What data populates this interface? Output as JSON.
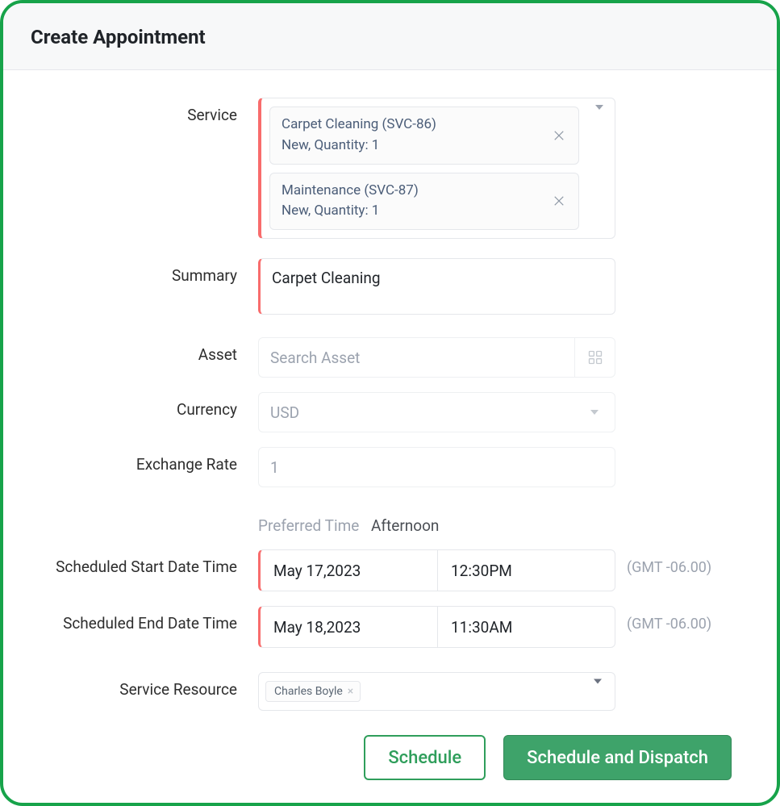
{
  "header": {
    "title": "Create Appointment"
  },
  "labels": {
    "service": "Service",
    "summary": "Summary",
    "asset": "Asset",
    "currency": "Currency",
    "exchange_rate": "Exchange Rate",
    "scheduled_start": "Scheduled Start Date Time",
    "scheduled_end": "Scheduled End Date Time",
    "service_resource": "Service Resource"
  },
  "services": [
    {
      "name": "Carpet Cleaning",
      "code": "(SVC-86)",
      "meta": "New,  Quantity: 1"
    },
    {
      "name": "Maintenance",
      "code": "(SVC-87)",
      "meta": "New,  Quantity: 1"
    }
  ],
  "summary": {
    "value": "Carpet Cleaning"
  },
  "asset": {
    "placeholder": "Search Asset"
  },
  "currency": {
    "value": "USD"
  },
  "exchange_rate": {
    "value": "1"
  },
  "preferred_time": {
    "label": "Preferred Time",
    "value": "Afternoon"
  },
  "scheduled_start": {
    "date": "May 17,2023",
    "time": "12:30PM",
    "tz": "(GMT -06.00)"
  },
  "scheduled_end": {
    "date": "May 18,2023",
    "time": "11:30AM",
    "tz": "(GMT -06.00)"
  },
  "resources": [
    {
      "name": "Charles Boyle"
    }
  ],
  "buttons": {
    "schedule": "Schedule",
    "schedule_dispatch": "Schedule and Dispatch"
  }
}
